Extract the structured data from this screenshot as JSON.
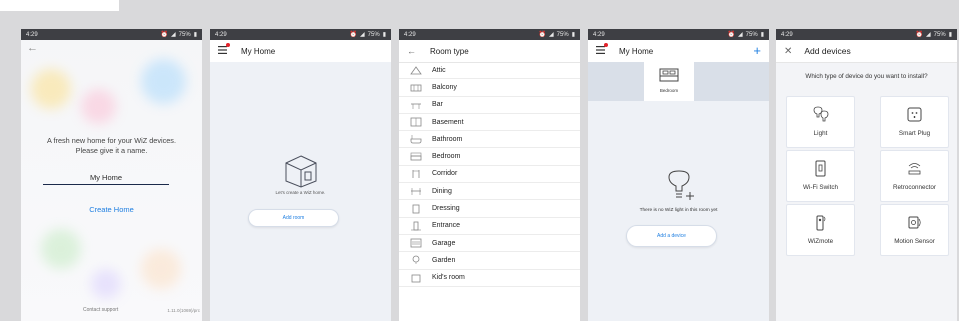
{
  "status": {
    "time": "4:29",
    "battery": "75%"
  },
  "screen1": {
    "message_line1": "A fresh new home for your WiZ devices.",
    "message_line2": "Please give it a name.",
    "home_name": "My Home",
    "create_label": "Create Home",
    "contact_label": "Contact support",
    "version": "1.11.0(1069)/prc"
  },
  "screen2": {
    "title": "My Home",
    "hero_text": "Let's create a WiZ home.",
    "add_room_label": "Add room"
  },
  "screen3": {
    "title": "Room type",
    "rooms": [
      "Attic",
      "Balcony",
      "Bar",
      "Basement",
      "Bathroom",
      "Bedroom",
      "Corridor",
      "Dining",
      "Dressing",
      "Entrance",
      "Garage",
      "Garden",
      "Kid's room"
    ]
  },
  "screen4": {
    "title": "My Home",
    "tab_label": "Bedroom",
    "empty_text": "There is no WiZ light in this room yet",
    "add_device_label": "Add a device"
  },
  "screen5": {
    "title": "Add devices",
    "question": "Which type of device do you want to install?",
    "devices": [
      "Light",
      "Smart Plug",
      "Wi-Fi Switch",
      "Retroconnector",
      "WiZmote",
      "Motion Sensor"
    ]
  },
  "colors": {
    "accent": "#1f7fe1",
    "statusbar": "#3e3f44"
  }
}
